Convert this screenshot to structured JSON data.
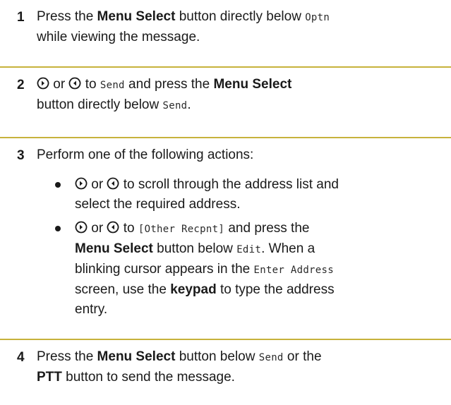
{
  "steps": [
    {
      "number": "1",
      "parts": {
        "t1": "Press the ",
        "b1": "Menu Select",
        "t2": " button directly below ",
        "m1": "Optn",
        "t3": "while viewing the message."
      }
    },
    {
      "number": "2",
      "parts": {
        "or1": " or ",
        "t1": " to ",
        "m1": "Send",
        "t2": " and press the ",
        "b1": "Menu Select",
        "t3": "button directly below ",
        "m2": "Send",
        "t4": "."
      }
    },
    {
      "number": "3",
      "parts": {
        "t1": "Perform one of the following actions:"
      },
      "bullets": [
        {
          "or1": " or ",
          "t1": " to scroll through the address list and",
          "t2": "select the required address."
        },
        {
          "or1": " or ",
          "t1": " to ",
          "m1": "[Other Recpnt]",
          "t2": " and press the",
          "b1": "Menu Select",
          "t3": " button below ",
          "m2": "Edit",
          "t4": ". When a",
          "t5": "blinking cursor appears in the ",
          "m3": "Enter Address",
          "t6": "screen, use the ",
          "b2": "keypad",
          "t7": " to type the address",
          "t8": "entry."
        }
      ]
    },
    {
      "number": "4",
      "parts": {
        "t1": "Press the ",
        "b1": "Menu Select",
        "t2": " button below ",
        "m1": "Send",
        "t3": " or the",
        "b2": "PTT",
        "t4": " button to send the message."
      }
    }
  ],
  "icons": {
    "right": "right-navigation-icon",
    "left": "left-navigation-icon"
  },
  "colors": {
    "rule": "#c7b23c",
    "text": "#1a1a1a"
  }
}
